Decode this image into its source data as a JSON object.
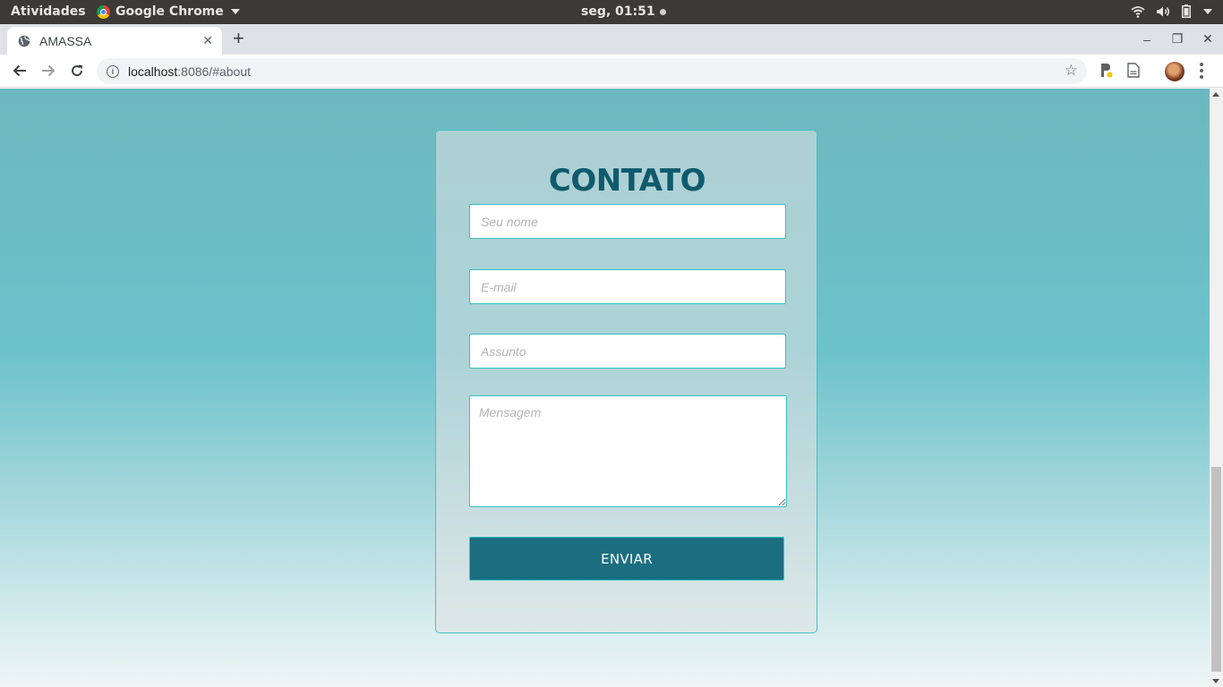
{
  "system": {
    "activities": "Atividades",
    "app_name": "Google Chrome",
    "clock": "seg, 01:51"
  },
  "browser": {
    "tab_title": "AMASSA",
    "url_host": "localhost",
    "url_rest": ":8086/#about"
  },
  "contact_form": {
    "title": "CONTATO",
    "name_placeholder": "Seu nome",
    "email_placeholder": "E-mail",
    "subject_placeholder": "Assunto",
    "message_placeholder": "Mensagem",
    "submit_label": "ENVIAR"
  },
  "colors": {
    "title": "#105a6d",
    "button": "#1b6e80",
    "field_border": "#32c3c3"
  },
  "icons": [
    "chrome-logo-icon",
    "wifi-icon",
    "volume-icon",
    "battery-icon",
    "globe-icon",
    "close-icon",
    "plus-icon",
    "minimize-icon",
    "restore-icon",
    "back-icon",
    "forward-icon",
    "reload-icon",
    "info-icon",
    "star-icon",
    "extension-icon",
    "reader-icon",
    "avatar",
    "menu-icon"
  ]
}
